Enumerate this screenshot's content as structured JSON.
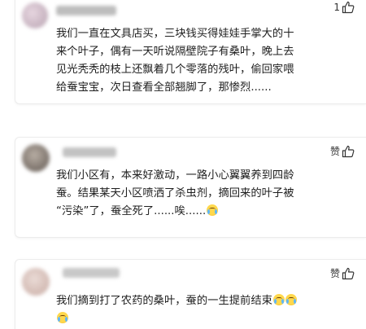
{
  "comments": [
    {
      "lines": [
        "我们一直在文具店买，三块钱买得娃娃手掌大的十",
        "来个叶子，偶有一天听说隔壁院子有桑叶，晚上去",
        "见光秃秃的枝上还飘着几个零落的残叶，偷回家喂",
        "给蚕宝宝，次日查看全部翘脚了，那惨烈......"
      ],
      "like_count": "1",
      "avatar_color": "#c9b7c2",
      "name_color": "#b9b9b9"
    },
    {
      "like_label": "赞",
      "lines": [
        "我们小区有，本来好激动，一路小心翼翼养到四龄",
        "蚕。结果某天小区喷洒了杀虫剂，摘回来的叶子被",
        "“污染”了，蚕全死了......唉......"
      ],
      "emoji": "crying-laughing-emoji",
      "avatar_color": "#8a7f76",
      "name_color": "#bdbdbd"
    },
    {
      "like_label": "赞",
      "lines": [
        "我们摘到打了农药的桑叶，蚕的一生提前结束"
      ],
      "emoji": "crying-laughing-emoji",
      "avatar_color": "#d9c3bd",
      "name_color": "#c4c4c4"
    }
  ]
}
